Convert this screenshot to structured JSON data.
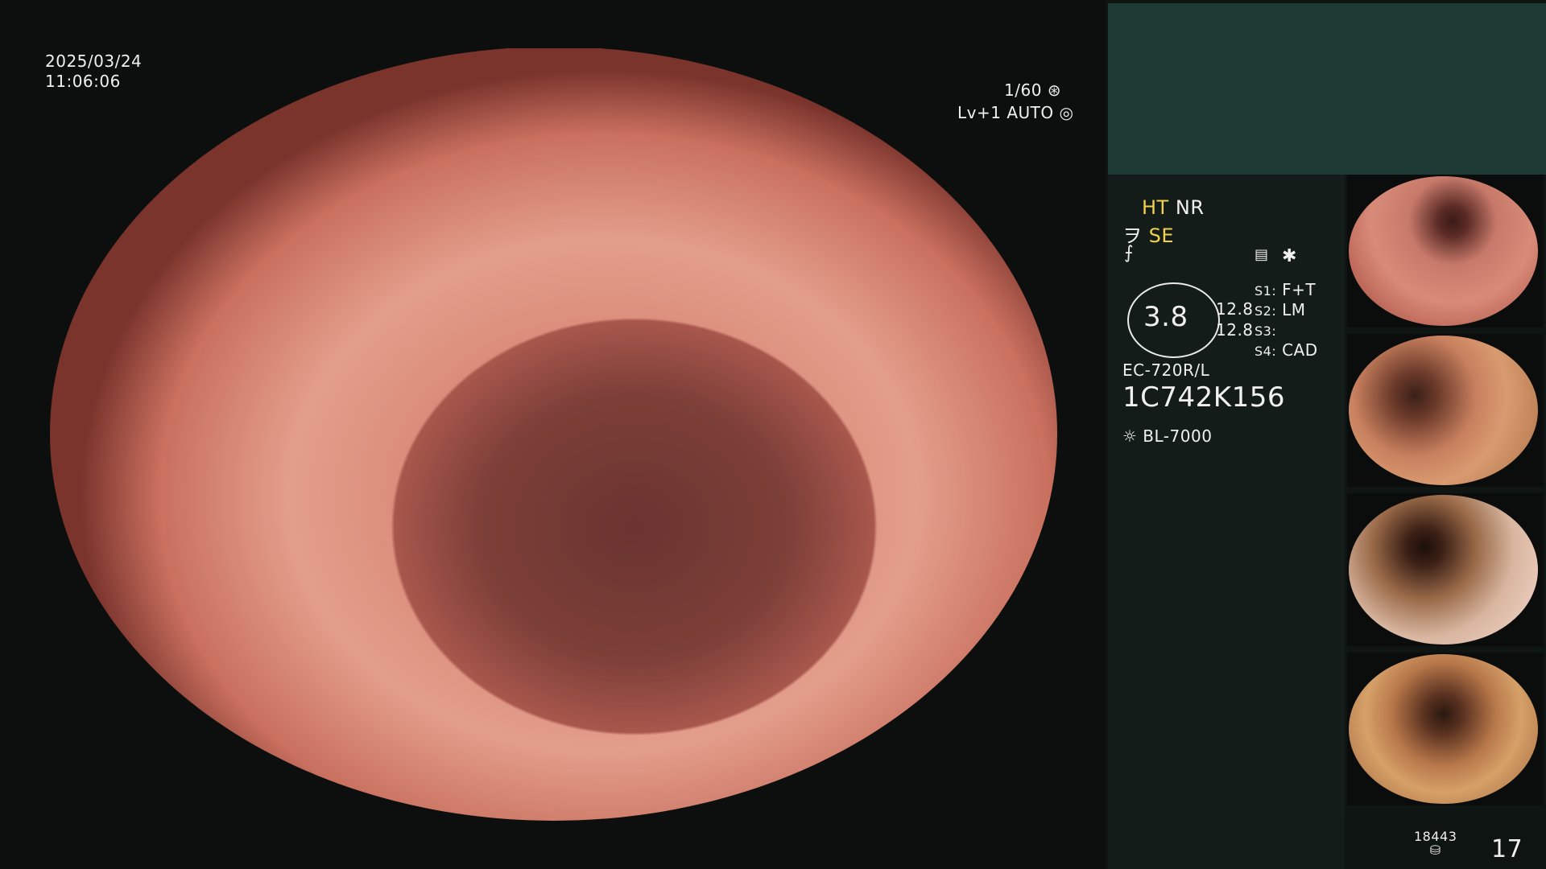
{
  "overlay": {
    "date": "2025/03/24",
    "time": "11:06:06",
    "shutter": "1/60",
    "level": "Lv+1",
    "mode": "AUTO"
  },
  "status": {
    "ht": "HT",
    "nr": "NR",
    "se": "SE",
    "gauge_value": "3.8",
    "gauge_line1": "12.8",
    "gauge_line2": "12.8",
    "s1_label": "S1:",
    "s1_value": "F+T",
    "s2_label": "S2:",
    "s2_value": "LM",
    "s3_label": "S3:",
    "s3_value": "",
    "s4_label": "S4:",
    "s4_value": "CAD",
    "scope_model": "EC-720R/L",
    "scope_serial": "1C742K156",
    "light_source": "BL-7000"
  },
  "footer": {
    "counter_small": "18443",
    "counter_large": "17"
  },
  "icons": {
    "shutter": "aperture-icon",
    "auto": "auto-iris-icon",
    "se": "se-mode-icon",
    "f": "function-icon",
    "settings": "settings-icon",
    "asterisk": "asterisk-icon",
    "light": "light-source-icon",
    "storage": "storage-icon"
  },
  "colors": {
    "accent_yellow": "#f1d24a",
    "panel_top": "#1e3a35",
    "panel_info": "#141c19"
  }
}
